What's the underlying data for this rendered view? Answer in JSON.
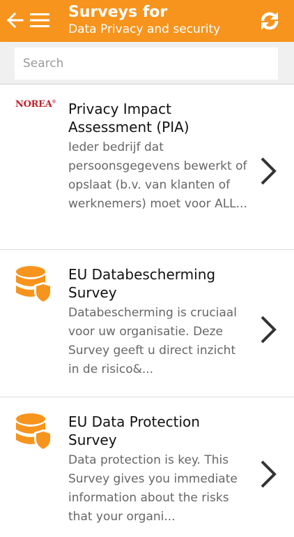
{
  "header": {
    "title": "Surveys for",
    "subtitle": "Data Privacy and security",
    "back_icon": "back-arrow-icon",
    "menu_icon": "hamburger-menu-icon",
    "refresh_icon": "refresh-icon",
    "bar_color": "#f7941d"
  },
  "search": {
    "placeholder": "Search",
    "value": ""
  },
  "surveys": [
    {
      "logo_text": "NOREA",
      "logo_icon": "norea-logo",
      "title": "Privacy Impact Assessment (PIA)",
      "description": "Ieder bedrijf dat persoonsgegevens bewerkt of opslaat (b.v. van klanten of werknemers) moet voor ALL..."
    },
    {
      "logo_icon": "database-shield-icon",
      "title": "EU Databescherming Survey",
      "description": "Databescherming is cruciaal voor uw organisatie.  Deze Survey geeft u direct inzicht in de risico&..."
    },
    {
      "logo_icon": "database-shield-icon",
      "title": "EU Data Protection Survey",
      "description": "Data protection is key. This Survey gives you immediate information about the risks that your organi..."
    }
  ]
}
